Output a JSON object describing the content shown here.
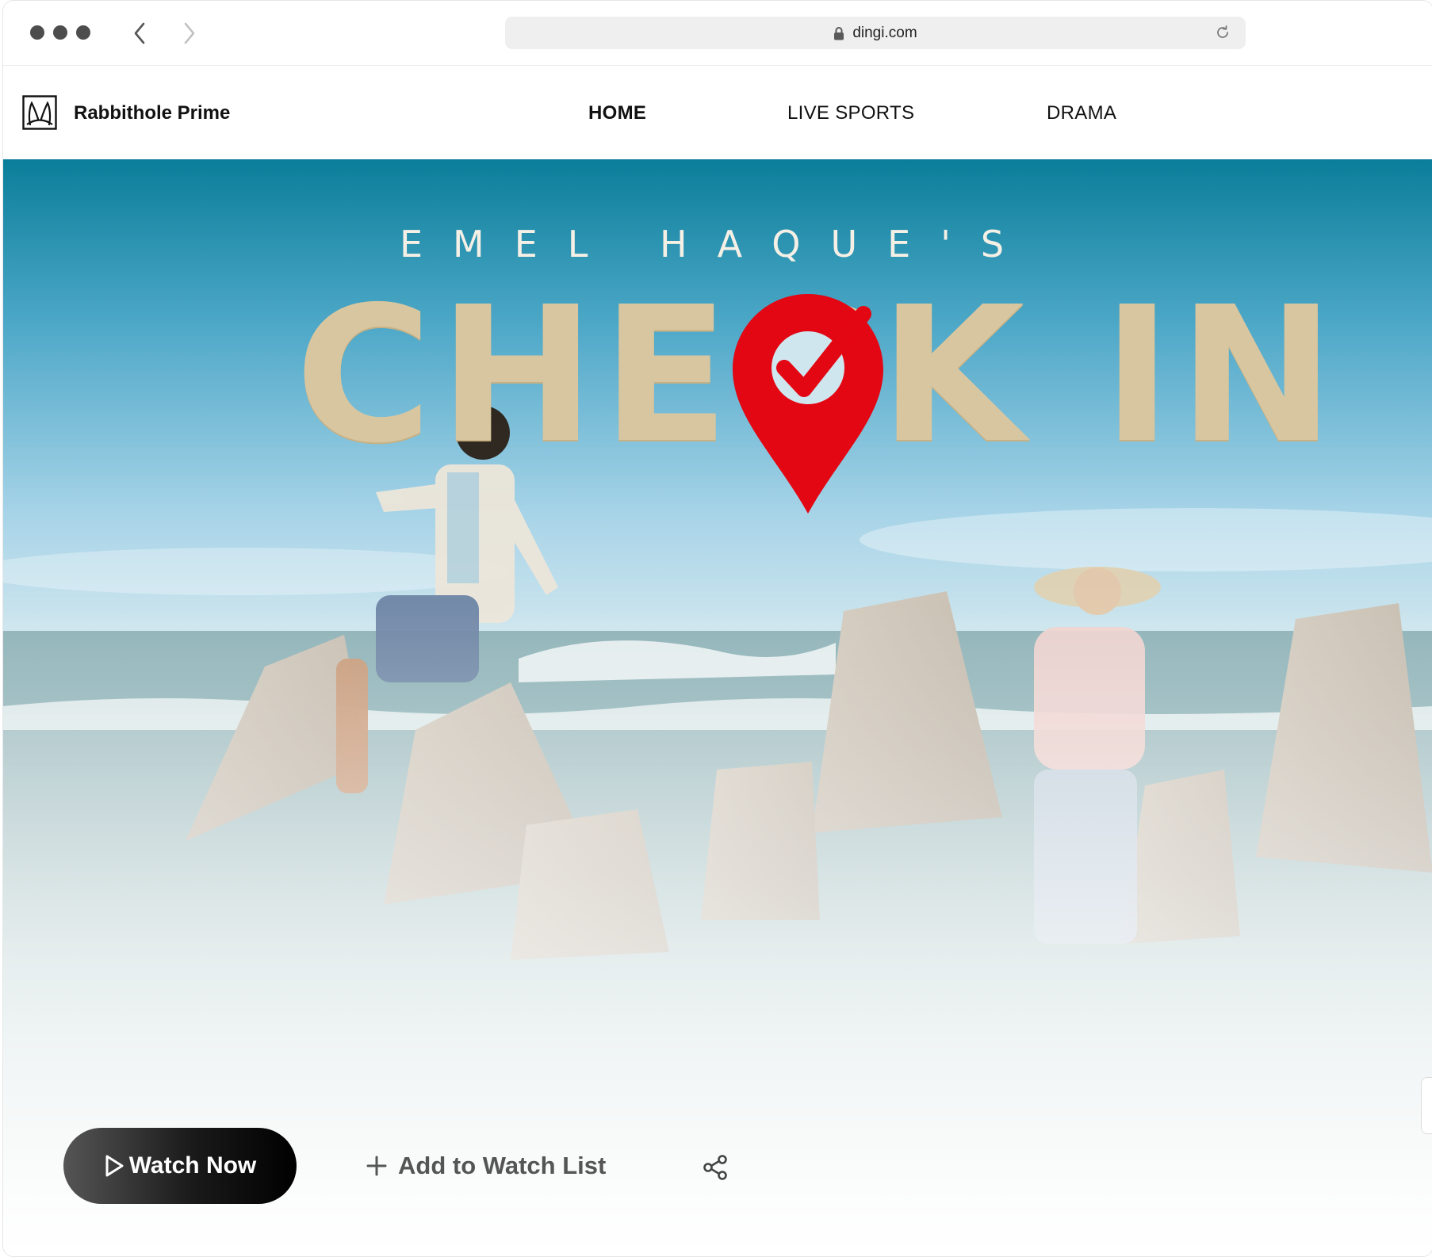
{
  "browser": {
    "url": "dingi.com",
    "icons": {
      "back": "chevron-left-icon",
      "forward": "chevron-right-icon",
      "lock": "lock-icon",
      "reload": "reload-icon"
    }
  },
  "site": {
    "brand": "Rabbithole Prime",
    "nav": [
      {
        "label": "HOME",
        "active": true
      },
      {
        "label": "LIVE SPORTS",
        "active": false
      },
      {
        "label": "DRAMA",
        "active": false
      }
    ]
  },
  "hero": {
    "subtitle": "EMEL HAQUE'S",
    "title": "CHECK IN",
    "accent_color": "#e30613"
  },
  "actions": {
    "watch_now": "Watch Now",
    "add_watchlist": "Add to Watch List",
    "icons": {
      "play": "play-icon",
      "plus": "plus-icon",
      "share": "share-icon"
    }
  }
}
